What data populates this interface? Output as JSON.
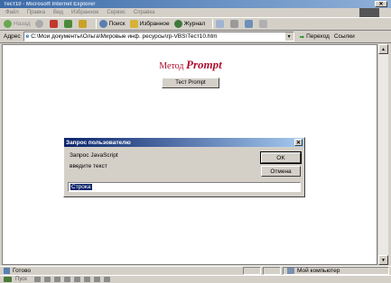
{
  "window": {
    "title": "Тест10 - Microsoft Internet Explorer",
    "window_button": "✕"
  },
  "menu": {
    "items": [
      "Файл",
      "Правка",
      "Вид",
      "Избранное",
      "Сервис",
      "Справка"
    ]
  },
  "toolbar": {
    "back": "Назад",
    "search": "Поиск",
    "favorites": "Избранное",
    "history": "Журнал"
  },
  "address": {
    "label": "Адрес",
    "value": "C:\\Мои документы\\Ольга\\Мировые инф. ресурсы\\rp-VBS\\Тест10.htm",
    "go": "Переход",
    "links": "Ссылки"
  },
  "page": {
    "title_part1": "Метод ",
    "title_part2": "Prompt",
    "test_button": "Тест Prompt"
  },
  "dialog": {
    "title": "Запрос пользователю",
    "message1": "Запрос JavaScript",
    "message2": "введите текст",
    "ok": "OK",
    "cancel": "Отмена",
    "input_value": "Строка",
    "close": "✕"
  },
  "status": {
    "left": "Готово",
    "zone": "Мой компьютер"
  },
  "taskbar": {
    "start": "Пуск"
  }
}
